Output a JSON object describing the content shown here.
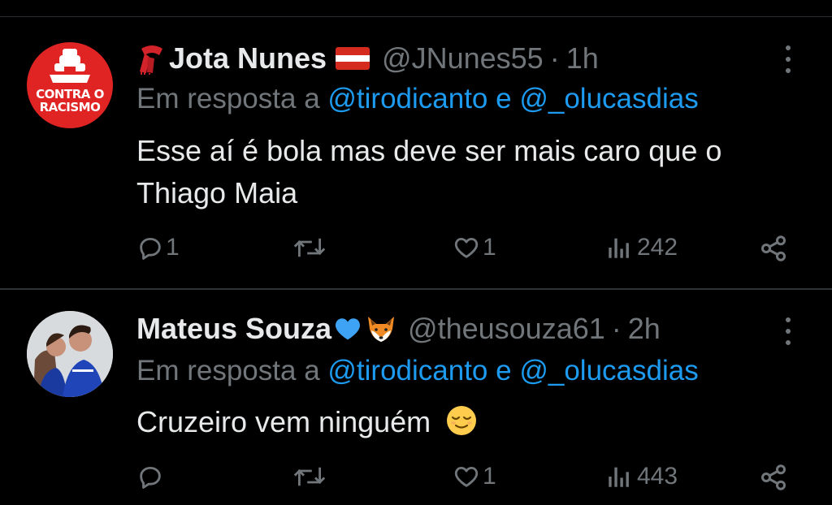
{
  "tweets": [
    {
      "avatar": {
        "text_line1": "CONTRA O",
        "text_line2": "RACISMO"
      },
      "name": "Jota Nunes",
      "handle": "@JNunes55",
      "separator": "·",
      "time": "1h",
      "reply_prefix": "Em resposta a",
      "reply_user1": "@tirodicanto",
      "reply_joiner": "e",
      "reply_user2": "@_olucasdias",
      "text": "Esse aí é bola mas deve ser mais caro que o Thiago Maia",
      "stats": {
        "replies": "1",
        "retweets": "",
        "likes": "1",
        "views": "242"
      }
    },
    {
      "name": "Mateus Souza",
      "name_emojis": [
        "blue-heart",
        "fox"
      ],
      "handle": "@theusouza61",
      "separator": "·",
      "time": "2h",
      "reply_prefix": "Em resposta a",
      "reply_user1": "@tirodicanto",
      "reply_joiner": "e",
      "reply_user2": "@_olucasdias",
      "text": "Cruzeiro vem ninguém",
      "text_emoji": "relieved-face",
      "stats": {
        "replies": "",
        "retweets": "",
        "likes": "1",
        "views": "443"
      }
    }
  ],
  "colors": {
    "background": "#000000",
    "text": "#e7e9ea",
    "muted": "#71767b",
    "mention": "#1d9bf0",
    "avatar_red": "#e02424"
  }
}
